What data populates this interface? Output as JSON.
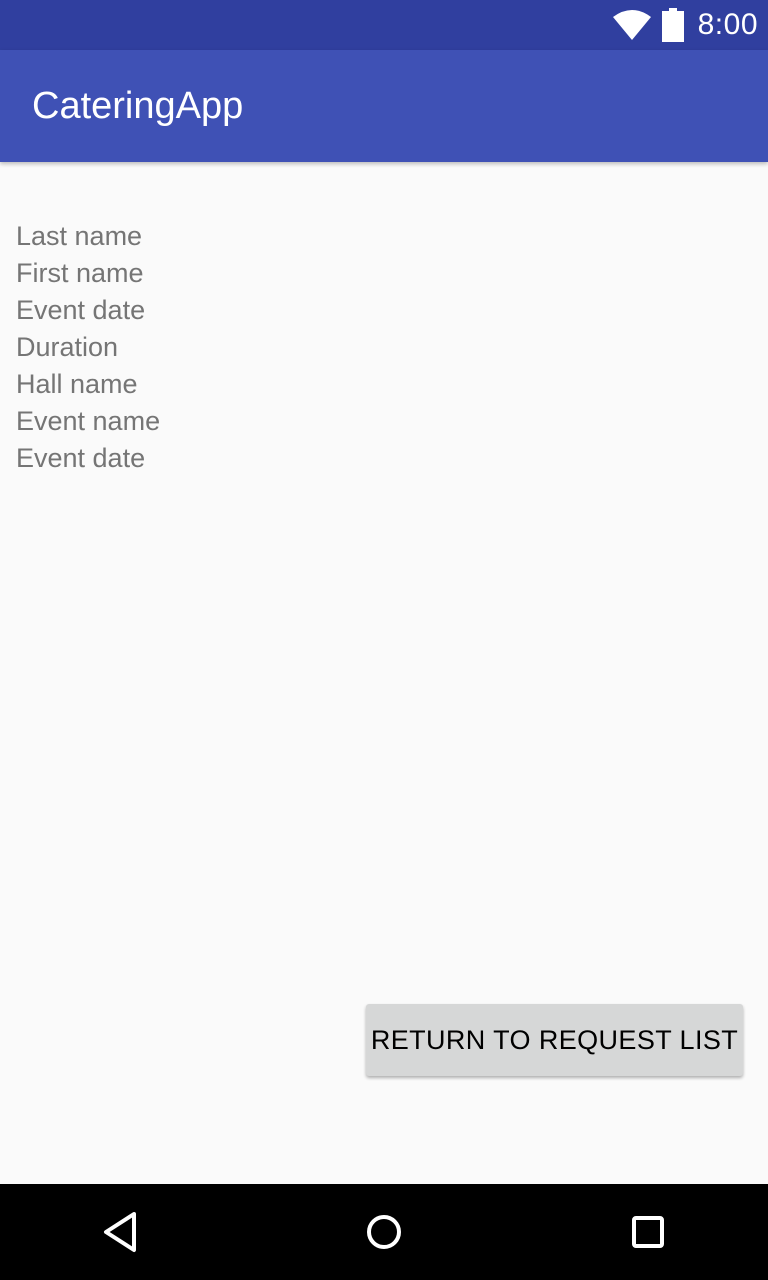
{
  "status_bar": {
    "time": "8:00",
    "icons": [
      "wifi-icon",
      "battery-icon"
    ],
    "background_color": "#303f9f"
  },
  "app_bar": {
    "title": "CateringApp",
    "background_color": "#3f51b5"
  },
  "details": {
    "fields": [
      "Last name",
      "First name",
      "Event date",
      "Duration",
      "Hall name",
      "Event name",
      "Event date"
    ]
  },
  "actions": {
    "return_label": "RETURN TO REQUEST LIST"
  },
  "nav_bar": {
    "icons": [
      "back-icon",
      "home-icon",
      "recent-apps-icon"
    ]
  }
}
